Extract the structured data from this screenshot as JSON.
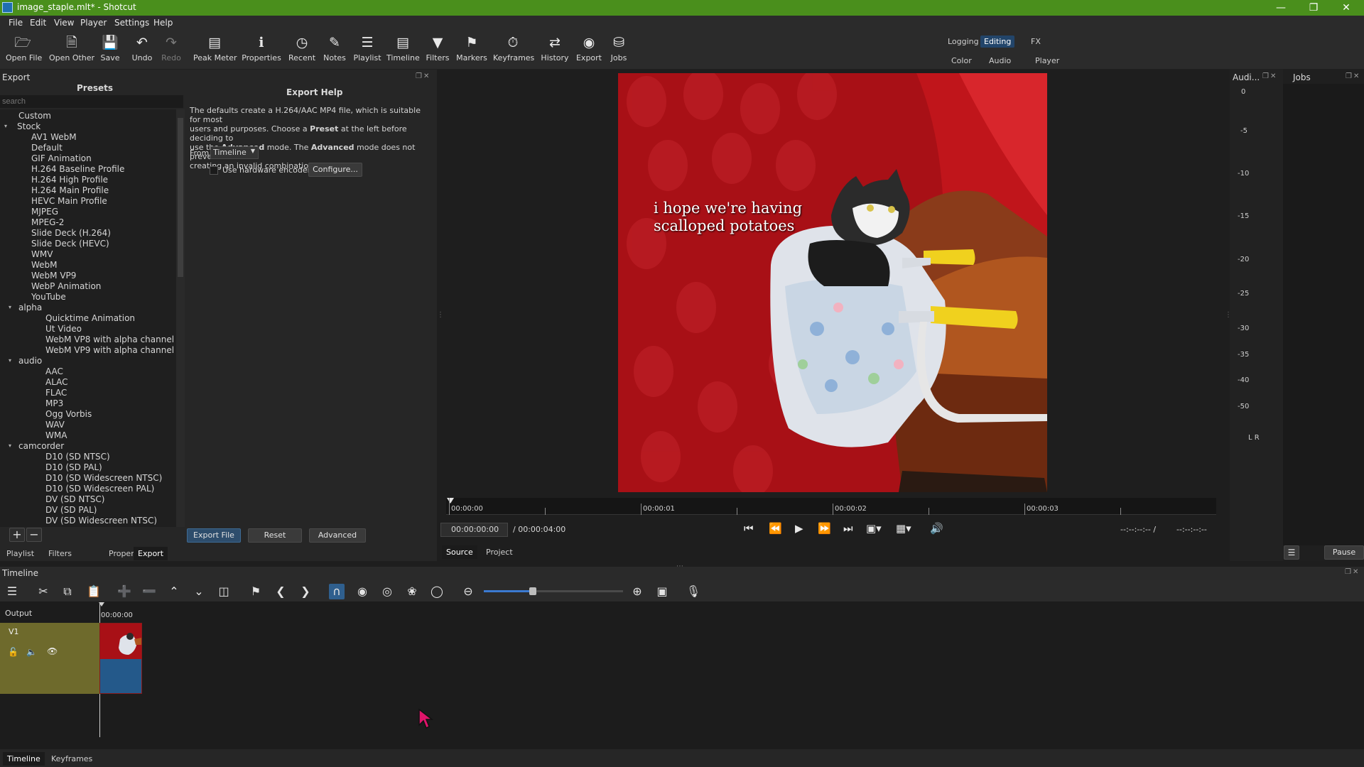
{
  "window": {
    "title": "image_staple.mlt* - Shotcut"
  },
  "menu": [
    "File",
    "Edit",
    "View",
    "Player",
    "Settings",
    "Help"
  ],
  "toolbar": [
    {
      "label": "Open File",
      "icon": "open-file-icon"
    },
    {
      "label": "Open Other",
      "icon": "open-other-icon"
    },
    {
      "label": "Save",
      "icon": "save-icon"
    },
    {
      "label": "Undo",
      "icon": "undo-icon"
    },
    {
      "label": "Redo",
      "icon": "redo-icon"
    },
    {
      "label": "Peak Meter",
      "icon": "peak-meter-icon"
    },
    {
      "label": "Properties",
      "icon": "properties-icon"
    },
    {
      "label": "Recent",
      "icon": "recent-icon"
    },
    {
      "label": "Notes",
      "icon": "notes-icon"
    },
    {
      "label": "Playlist",
      "icon": "playlist-icon"
    },
    {
      "label": "Timeline",
      "icon": "timeline-icon"
    },
    {
      "label": "Filters",
      "icon": "filters-icon"
    },
    {
      "label": "Markers",
      "icon": "markers-icon"
    },
    {
      "label": "Keyframes",
      "icon": "keyframes-icon"
    },
    {
      "label": "History",
      "icon": "history-icon"
    },
    {
      "label": "Export",
      "icon": "export-icon"
    },
    {
      "label": "Jobs",
      "icon": "jobs-icon"
    }
  ],
  "layouts": {
    "logging": "Logging",
    "editing": "Editing",
    "fx": "FX",
    "color": "Color",
    "audio": "Audio",
    "player": "Player"
  },
  "export": {
    "panel_title": "Export",
    "presets_header": "Presets",
    "search_placeholder": "search",
    "help_title": "Export Help",
    "help_text_1": "The defaults create a H.264/AAC MP4 file, which is suitable for most",
    "help_text_2": "users and purposes. Choose a",
    "help_text_2b": "Preset",
    "help_text_2c": "at the left before deciding to",
    "help_text_3": "use the",
    "help_text_3b": "Advanced",
    "help_text_3c": "mode. The",
    "help_text_3d": "Advanced",
    "help_text_3e": "mode does not prevent",
    "help_text_4": "creating an invalid combination of options!",
    "from_label": "From",
    "from_value": "Timeline",
    "hw_encoder": "Use hardware encoder",
    "configure": "Configure...",
    "export_file": "Export File",
    "reset": "Reset",
    "advanced": "Advanced",
    "presets": [
      {
        "label": "Custom",
        "level": 1
      },
      {
        "label": "Stock",
        "level": 0,
        "caret": true
      },
      {
        "label": "AV1 WebM",
        "level": 2
      },
      {
        "label": "Default",
        "level": 2
      },
      {
        "label": "GIF Animation",
        "level": 2
      },
      {
        "label": "H.264 Baseline Profile",
        "level": 2
      },
      {
        "label": "H.264 High Profile",
        "level": 2
      },
      {
        "label": "H.264 Main Profile",
        "level": 2
      },
      {
        "label": "HEVC Main Profile",
        "level": 2
      },
      {
        "label": "MJPEG",
        "level": 2
      },
      {
        "label": "MPEG-2",
        "level": 2
      },
      {
        "label": "Slide Deck (H.264)",
        "level": 2
      },
      {
        "label": "Slide Deck (HEVC)",
        "level": 2
      },
      {
        "label": "WMV",
        "level": 2
      },
      {
        "label": "WebM",
        "level": 2
      },
      {
        "label": "WebM VP9",
        "level": 2
      },
      {
        "label": "WebP Animation",
        "level": 2
      },
      {
        "label": "YouTube",
        "level": 2
      },
      {
        "label": "alpha",
        "level": 1,
        "caret": true
      },
      {
        "label": "Quicktime Animation",
        "level": 3
      },
      {
        "label": "Ut Video",
        "level": 3
      },
      {
        "label": "WebM VP8 with alpha channel",
        "level": 3
      },
      {
        "label": "WebM VP9 with alpha channel",
        "level": 3
      },
      {
        "label": "audio",
        "level": 1,
        "caret": true
      },
      {
        "label": "AAC",
        "level": 3
      },
      {
        "label": "ALAC",
        "level": 3
      },
      {
        "label": "FLAC",
        "level": 3
      },
      {
        "label": "MP3",
        "level": 3
      },
      {
        "label": "Ogg Vorbis",
        "level": 3
      },
      {
        "label": "WAV",
        "level": 3
      },
      {
        "label": "WMA",
        "level": 3
      },
      {
        "label": "camcorder",
        "level": 1,
        "caret": true
      },
      {
        "label": "D10 (SD NTSC)",
        "level": 3
      },
      {
        "label": "D10 (SD PAL)",
        "level": 3
      },
      {
        "label": "D10 (SD Widescreen NTSC)",
        "level": 3
      },
      {
        "label": "D10 (SD Widescreen PAL)",
        "level": 3
      },
      {
        "label": "DV (SD NTSC)",
        "level": 3
      },
      {
        "label": "DV (SD PAL)",
        "level": 3
      },
      {
        "label": "DV (SD Widescreen NTSC)",
        "level": 3
      }
    ]
  },
  "left_tabs": [
    "Playlist",
    "Filters",
    "Properties",
    "Export"
  ],
  "player": {
    "caption_line1": "i hope we're having",
    "caption_line2": "scalloped potatoes",
    "ruler_labels": [
      "00:00:00",
      "00:00:01",
      "00:00:02",
      "00:00:03"
    ],
    "position": "00:00:00:00",
    "duration": "/ 00:00:04:00",
    "in_point": "--:--:--:-- /",
    "out_point": "--:--:--:--",
    "source_tab": "Source",
    "project_tab": "Project"
  },
  "audio_meter": {
    "title": "Audi...",
    "db_labels": [
      "0",
      "-5",
      "-10",
      "-15",
      "-20",
      "-25",
      "-30",
      "-35",
      "-40",
      "-50"
    ],
    "channels": "L R"
  },
  "jobs": {
    "title": "Jobs",
    "pause": "Pause"
  },
  "timeline": {
    "title": "Timeline",
    "output_label": "Output",
    "track_label": "V1",
    "ruler_time": "00:00:00",
    "zoom_level": 0.35
  },
  "bottom_tabs": [
    "Timeline",
    "Keyframes"
  ]
}
